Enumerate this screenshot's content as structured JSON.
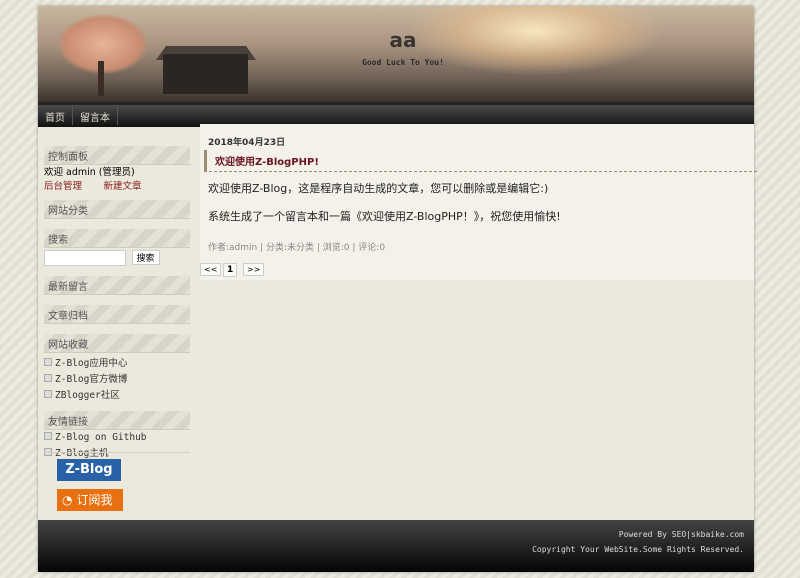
{
  "header": {
    "title": "aa",
    "subtitle": "Good Luck To You!"
  },
  "nav": [
    "首页",
    "留言本"
  ],
  "sidebar": {
    "control": {
      "title": "控制面板",
      "welcome": "欢迎 admin (管理员)",
      "admin": "后台管理",
      "new_post": "新建文章"
    },
    "categories": "网站分类",
    "search": {
      "title": "搜索",
      "button": "搜索",
      "value": ""
    },
    "recent_comments": "最新留言",
    "archives": "文章归档",
    "favorites": {
      "title": "网站收藏",
      "items": [
        "Z-Blog应用中心",
        "Z-Blog官方微博",
        "ZBlogger社区"
      ]
    },
    "links": {
      "title": "友情链接",
      "items": [
        "Z-Blog on Github",
        "Z-Blog主机"
      ]
    },
    "zblog_badge": "Z-Blog",
    "rss": "订阅我"
  },
  "post": {
    "date": "2018年04月23日",
    "title": "欢迎使用Z-BlogPHP!",
    "p1": "欢迎使用Z-Blog，这是程序自动生成的文章，您可以删除或是编辑它:)",
    "p2": "系统生成了一个留言本和一篇《欢迎使用Z-BlogPHP！》，祝您使用愉快!",
    "meta": "作者:admin | 分类:未分类 | 浏览:0 | 评论:0"
  },
  "pager": {
    "prev": "<<",
    "page": "1",
    "next": ">>"
  },
  "footer": {
    "powered": "Powered By SEO|skbaike.com",
    "copyright": "Copyright Your WebSite.Some Rights Reserved."
  }
}
